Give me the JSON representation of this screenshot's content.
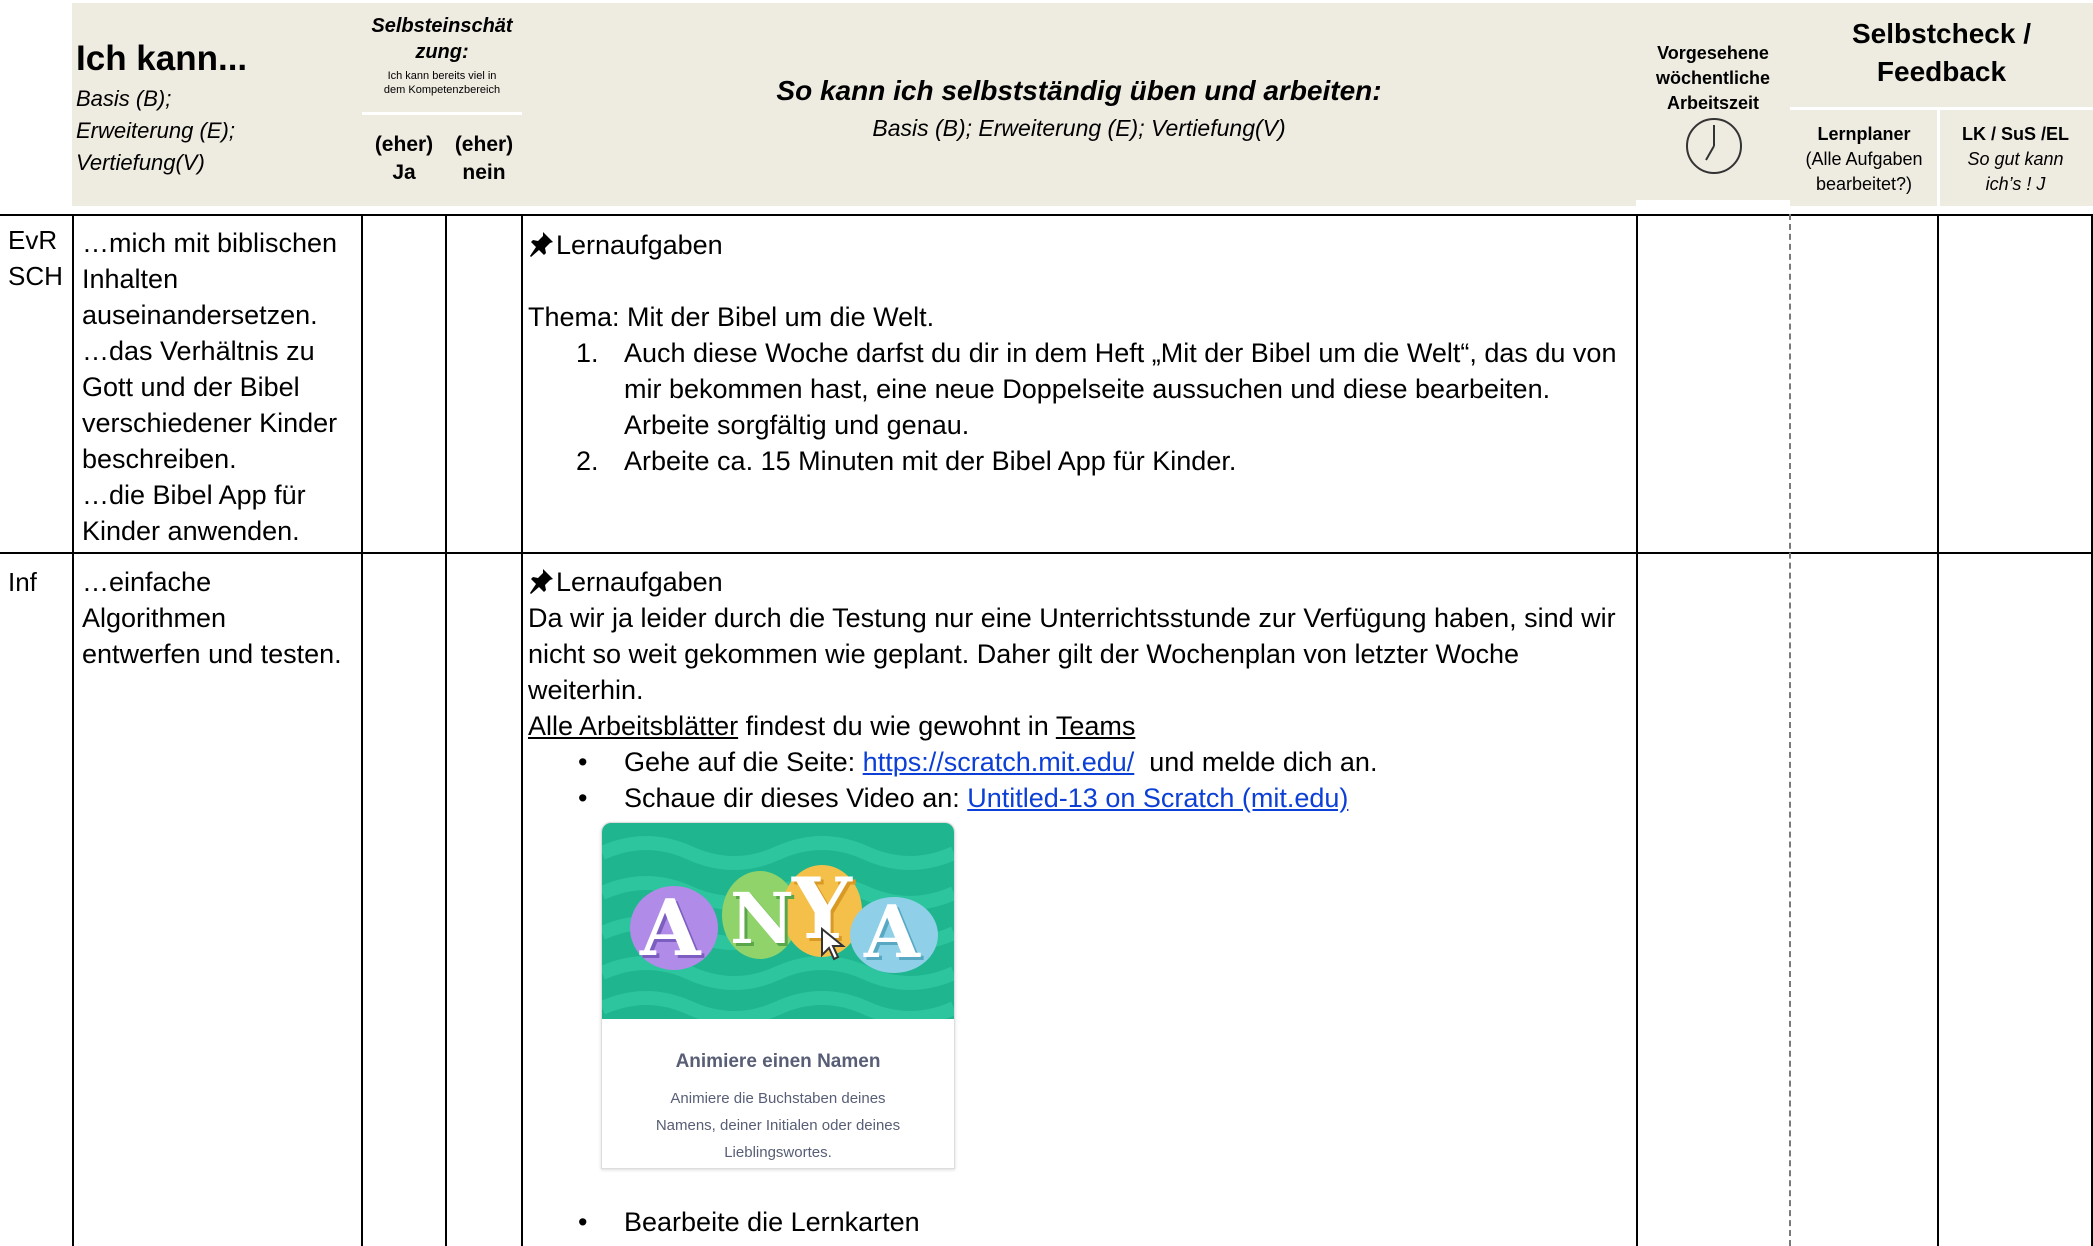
{
  "header": {
    "ich_kann_title": "Ich kann...",
    "ich_kann_levels": [
      "Basis (B);",
      "Erweiterung (E);",
      "Vertiefung(V)"
    ],
    "selbst_title_l1": "Selbsteinschät",
    "selbst_title_l2": "zung:",
    "selbst_sub_l1": "Ich kann bereits viel in",
    "selbst_sub_l2": "dem Kompetenzbereich",
    "ja_l1": "(eher)",
    "ja_l2": "Ja",
    "nein_l1": "(eher)",
    "nein_l2": "nein",
    "task_title": "So kann ich selbstständig üben und arbeiten:",
    "task_sub": "Basis (B); Erweiterung (E); Vertiefung(V)",
    "time_l1": "Vorgesehene",
    "time_l2": "wöchentliche",
    "time_l3": "Arbeitszeit",
    "check_l1": "Selbstcheck /",
    "check_l2": "Feedback",
    "lp_title": "Lernplaner",
    "lp_sub_l1": "(Alle Aufgaben",
    "lp_sub_l2": "bearbeitet?)",
    "lk_title": "LK / SuS /EL",
    "lk_sub_l1": "So gut kann",
    "lk_sub_l2": "ich’s ! J"
  },
  "row1": {
    "subject_l1": "EvR",
    "subject_l2": "SCH",
    "kann_lines": [
      "…mich mit biblischen",
      "Inhalten",
      "auseinandersetzen.",
      "…das Verhältnis zu",
      "Gott und der Bibel",
      "verschiedener Kinder",
      "beschreiben.",
      "…die Bibel App für",
      "Kinder anwenden."
    ],
    "task_heading": "Lernaufgaben",
    "theme": "Thema: Mit der Bibel um die Welt.",
    "items": [
      {
        "num": "1.",
        "lines": [
          "Auch diese Woche darfst du dir in dem Heft „Mit der Bibel um die Welt“, das du von",
          "mir bekommen hast, eine neue Doppelseite aussuchen und diese bearbeiten.",
          "Arbeite sorgfältig und genau."
        ]
      },
      {
        "num": "2.",
        "lines": [
          "Arbeite ca. 15 Minuten mit der Bibel App für Kinder."
        ]
      }
    ]
  },
  "row2": {
    "subject": "Inf",
    "kann_lines": [
      "…einfache",
      "Algorithmen",
      "entwerfen und testen."
    ],
    "task_heading": "Lernaufgaben",
    "intro_lines": [
      "Da wir ja leider durch die Testung nur eine Unterrichtsstunde zur Verfügung haben, sind wir",
      "nicht so weit gekommen wie geplant. Daher gilt der Wochenplan von letzter Woche",
      "weiterhin."
    ],
    "worksheets_link": "Alle Arbeitsblätter",
    "worksheets_mid": " findest du wie gewohnt in ",
    "teams_link": "Teams",
    "bullet1_text": "Gehe auf die Seite: ",
    "bullet1_link": "https://scratch.mit.edu/",
    "bullet1_after": "  und melde dich an.",
    "bullet2_text": "Schaue dir dieses Video an: ",
    "bullet2_link": "Untitled-13 on Scratch (mit.edu)",
    "bullet3_text": "Bearbeite die Lernkarten",
    "bullet_char": "•",
    "card": {
      "logo_letters": [
        "A",
        "N",
        "Y",
        "A"
      ],
      "title": "Animiere einen Namen",
      "desc_l1": "Animiere die Buchstaben deines",
      "desc_l2": "Namens, deiner Initialen oder deines",
      "desc_l3": "Lieblingswortes."
    }
  },
  "icons": {
    "pin": "pushpin-icon",
    "clock": "clock-icon"
  },
  "colors": {
    "header_bg": "#eeebe1",
    "link": "#0b3fd6",
    "scratch_green": "#1fb58f"
  }
}
